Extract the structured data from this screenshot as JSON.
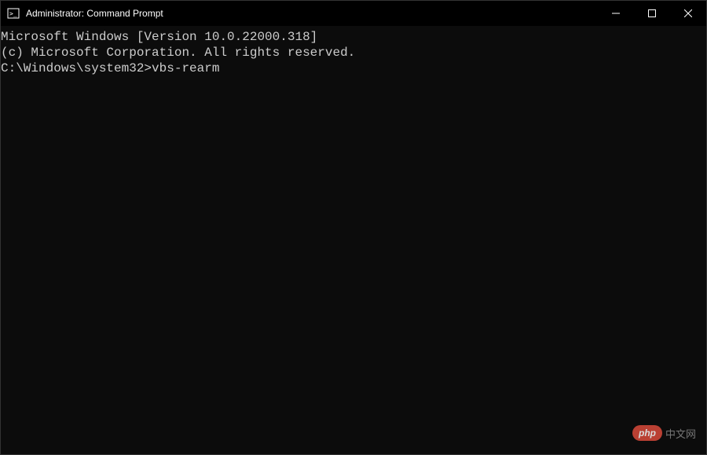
{
  "window": {
    "title": "Administrator: Command Prompt"
  },
  "terminal": {
    "line1": "Microsoft Windows [Version 10.0.22000.318]",
    "line2": "(c) Microsoft Corporation. All rights reserved.",
    "blank": "",
    "prompt": "C:\\Windows\\system32>",
    "command": "vbs-rearm"
  },
  "watermark": {
    "badge": "php",
    "text": "中文网"
  }
}
